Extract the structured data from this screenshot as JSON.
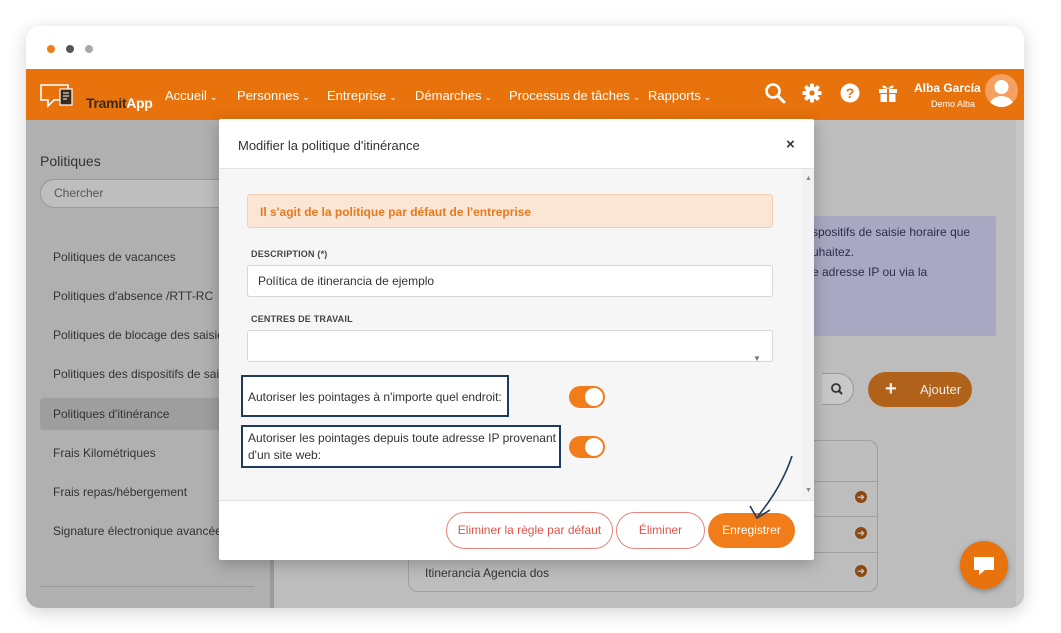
{
  "app": {
    "logo_text": "TramitApp",
    "logo_bold": "Tramit",
    "logo_rest": "App"
  },
  "nav": {
    "items": [
      {
        "label": "Accueil"
      },
      {
        "label": "Personnes"
      },
      {
        "label": "Entreprise"
      },
      {
        "label": "Démarches"
      },
      {
        "label": "Processus de tâches"
      },
      {
        "label": "Rapports"
      }
    ],
    "caret": "⌄",
    "icons": [
      "search-icon",
      "gear-icon",
      "help-icon",
      "gift-icon"
    ],
    "user_name": "Alba García",
    "user_company": "Demo Alba"
  },
  "sidebar": {
    "title": "Politiques",
    "search_placeholder": "Chercher",
    "items": [
      {
        "label": "Politiques de vacances"
      },
      {
        "label": "Politiques d'absence /RTT-RC"
      },
      {
        "label": "Politiques de blocage des saisies"
      },
      {
        "label": "Politiques des dispositifs de saisi"
      },
      {
        "label": "Politiques d'itinérance"
      },
      {
        "label": "Frais Kilométriques"
      },
      {
        "label": "Frais repas/hébergement"
      },
      {
        "label": "Signature électronique avancée"
      }
    ],
    "active_index": 4
  },
  "main": {
    "info_lines": [
      "spositifs de saisie horaire que",
      "uhaitez.",
      "e adresse IP ou via la"
    ],
    "add_button_icon": "+",
    "add_button_label": "Ajouter",
    "list_last_row": "Itinerancia Agencia dos"
  },
  "modal": {
    "title": "Modifier la politique d'itinérance",
    "close_label": "×",
    "alert": "Il s'agit de la politique par défaut de l'entreprise",
    "description_label": "DESCRIPTION (*)",
    "description_value": "Política de itinerancia de ejemplo",
    "work_centers_label": "CENTRES DE TRAVAIL",
    "work_centers_value": "",
    "toggle1_label": "Autoriser les pointages à n'importe quel endroit:",
    "toggle1_on": true,
    "toggle2_label_line1": "Autoriser les pointages depuis toute adresse IP provenant",
    "toggle2_label_line2": "d'un site web:",
    "toggle2_on": true,
    "btn_remove_default": "Eliminer la règle par défaut",
    "btn_delete": "Éliminer",
    "btn_save": "Enregistrer"
  },
  "colors": {
    "brand": "#e8720c",
    "toggle_on": "#f07d1a",
    "danger": "#e0534a",
    "highlight_border": "#1f3b5c"
  }
}
